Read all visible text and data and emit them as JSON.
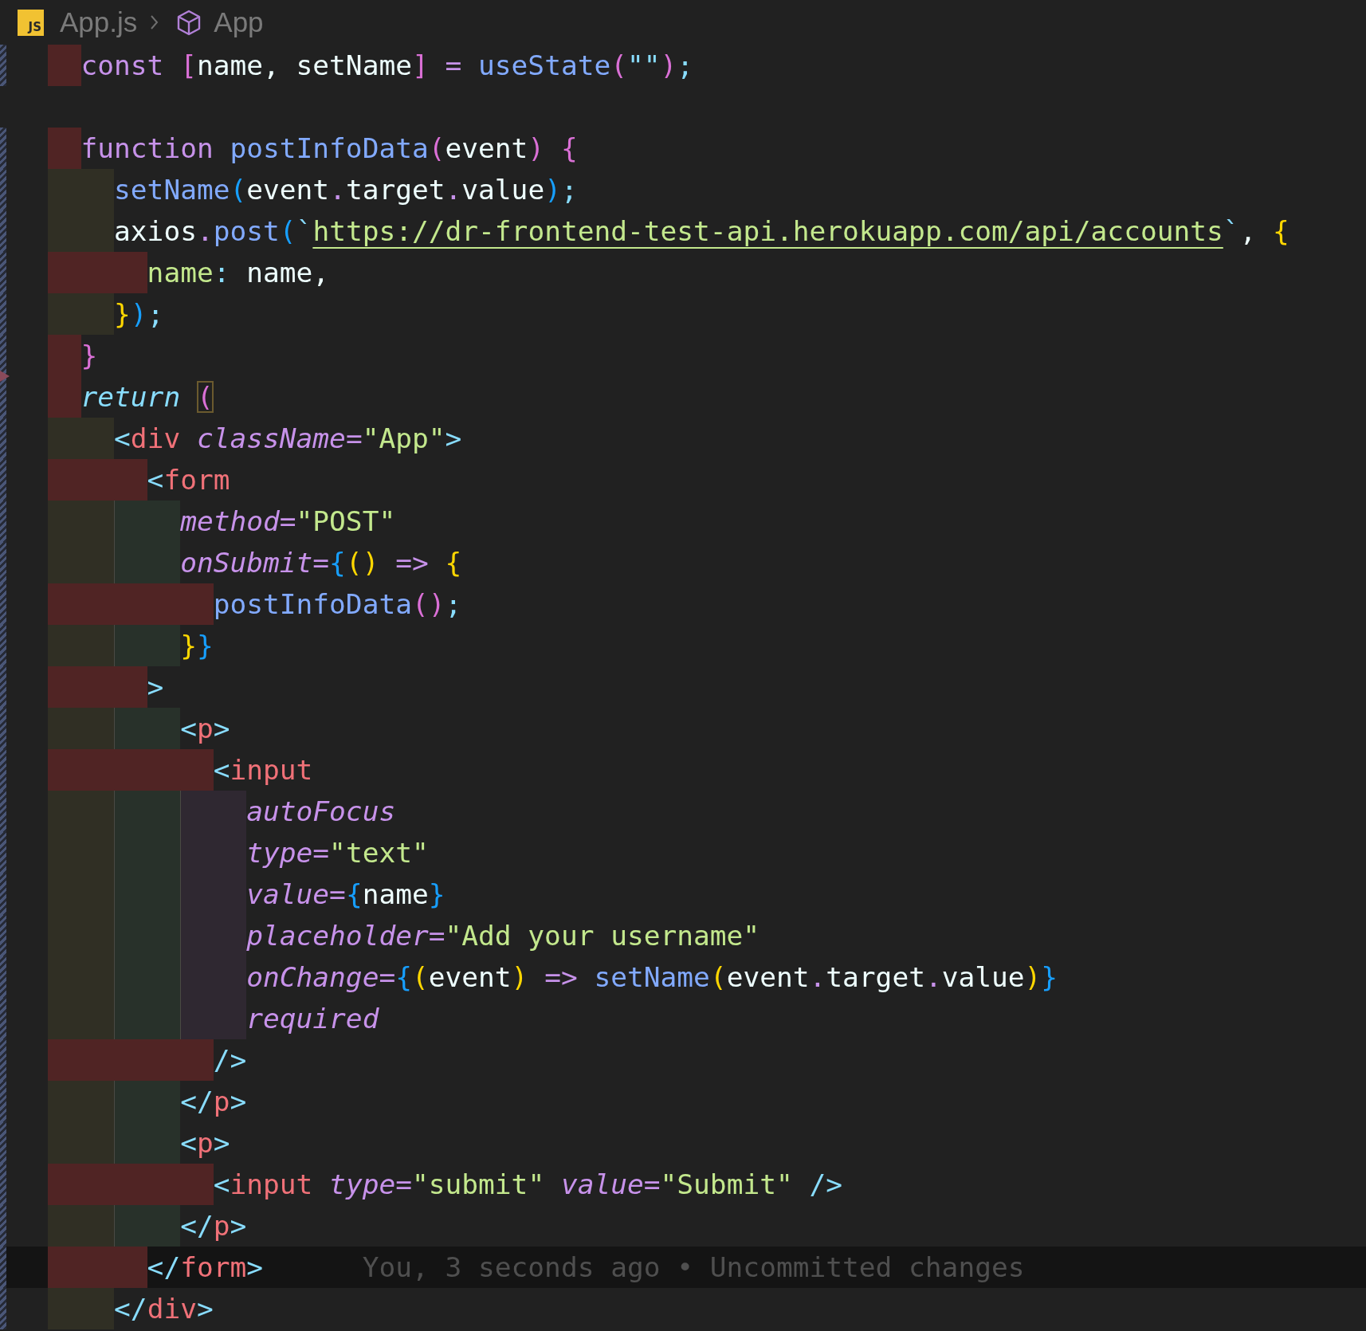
{
  "breadcrumbs": {
    "file_icon_label": "JS",
    "file": "App.js",
    "symbol": "App"
  },
  "lines": [
    {
      "changed": true,
      "tokens": [
        {
          "kind": "kw",
          "text": "const "
        },
        {
          "kind": "b2",
          "text": "["
        },
        {
          "kind": "var",
          "text": "name, setName"
        },
        {
          "kind": "b2",
          "text": "]"
        },
        {
          "kind": "op",
          "text": " = "
        },
        {
          "kind": "fn",
          "text": "useState"
        },
        {
          "kind": "b2",
          "text": "("
        },
        {
          "kind": "punc",
          "text": "\"\""
        },
        {
          "kind": "b2",
          "text": ")"
        },
        {
          "kind": "punc",
          "text": ";"
        }
      ]
    },
    {
      "changed": false
    },
    {
      "changed": true,
      "tokens": [
        {
          "kind": "kw",
          "text": "function "
        },
        {
          "kind": "fn",
          "text": "postInfoData"
        },
        {
          "kind": "b2",
          "text": "("
        },
        {
          "kind": "var",
          "text": "event"
        },
        {
          "kind": "b2",
          "text": ") {"
        }
      ],
      "children": [
        {
          "changed": true,
          "tokens": [
            {
              "kind": "fn",
              "text": "setName"
            },
            {
              "kind": "b3",
              "text": "("
            },
            {
              "kind": "var",
              "text": "event"
            },
            {
              "kind": "op",
              "text": "."
            },
            {
              "kind": "var",
              "text": "target"
            },
            {
              "kind": "op",
              "text": "."
            },
            {
              "kind": "var",
              "text": "value"
            },
            {
              "kind": "b3",
              "text": ")"
            },
            {
              "kind": "punc",
              "text": ";"
            }
          ]
        },
        {
          "changed": true,
          "tokens": [
            {
              "kind": "var",
              "text": "axios"
            },
            {
              "kind": "op",
              "text": "."
            },
            {
              "kind": "fn",
              "text": "post"
            },
            {
              "kind": "b3",
              "text": "("
            },
            {
              "kind": "punc",
              "text": "`"
            },
            {
              "kind": "link",
              "text": "https://dr-frontend-test-api.herokuapp.com/api/accounts"
            },
            {
              "kind": "punc",
              "text": "`"
            },
            {
              "kind": "var",
              "text": ", "
            },
            {
              "kind": "b1",
              "text": "{"
            }
          ],
          "children": [
            {
              "changed": true,
              "tokens": [
                {
                  "kind": "prop",
                  "text": "name"
                },
                {
                  "kind": "punc",
                  "text": ": "
                },
                {
                  "kind": "var",
                  "text": "name,"
                }
              ]
            }
          ]
        },
        {
          "changed": true,
          "tokens": [
            {
              "kind": "b1",
              "text": "}"
            },
            {
              "kind": "b3",
              "text": ")"
            },
            {
              "kind": "punc",
              "text": ";"
            }
          ]
        }
      ]
    },
    {
      "changed": true,
      "tokens": [
        {
          "kind": "b2",
          "text": "}"
        }
      ]
    },
    {
      "changed": true,
      "deleted_above": true,
      "tokens": [
        {
          "kind": "kwi",
          "text": "return "
        },
        {
          "kind": "bmatch",
          "text": "("
        }
      ],
      "children": [
        {
          "changed": true,
          "tokens": [
            {
              "kind": "punc",
              "text": "<"
            },
            {
              "kind": "tag",
              "text": "div "
            },
            {
              "kind": "attr",
              "text": "className"
            },
            {
              "kind": "op",
              "text": "="
            },
            {
              "kind": "str",
              "text": "\"App\""
            },
            {
              "kind": "punc",
              "text": ">"
            }
          ],
          "children": [
            {
              "changed": true,
              "tokens": [
                {
                  "kind": "punc",
                  "text": "<"
                },
                {
                  "kind": "tag",
                  "text": "form"
                }
              ],
              "children": [
                {
                  "changed": true,
                  "tokens": [
                    {
                      "kind": "attr",
                      "text": "method"
                    },
                    {
                      "kind": "op",
                      "text": "="
                    },
                    {
                      "kind": "str",
                      "text": "\"POST\""
                    }
                  ]
                },
                {
                  "changed": true,
                  "tokens": [
                    {
                      "kind": "attr",
                      "text": "onSubmit"
                    },
                    {
                      "kind": "op",
                      "text": "="
                    },
                    {
                      "kind": "b3",
                      "text": "{"
                    },
                    {
                      "kind": "b1",
                      "text": "()"
                    },
                    {
                      "kind": "op",
                      "text": " => "
                    },
                    {
                      "kind": "b1",
                      "text": "{"
                    }
                  ],
                  "children": [
                    {
                      "changed": true,
                      "tokens": [
                        {
                          "kind": "fn",
                          "text": "postInfoData"
                        },
                        {
                          "kind": "b2",
                          "text": "()"
                        },
                        {
                          "kind": "punc",
                          "text": ";"
                        }
                      ]
                    }
                  ]
                },
                {
                  "changed": true,
                  "tokens": [
                    {
                      "kind": "b1",
                      "text": "}"
                    },
                    {
                      "kind": "b3",
                      "text": "}"
                    }
                  ]
                }
              ]
            },
            {
              "changed": true,
              "tokens": [
                {
                  "kind": "punc",
                  "text": ">"
                }
              ],
              "children": [
                {
                  "changed": true,
                  "tokens": [
                    {
                      "kind": "punc",
                      "text": "<"
                    },
                    {
                      "kind": "tag",
                      "text": "p"
                    },
                    {
                      "kind": "punc",
                      "text": ">"
                    }
                  ],
                  "children": [
                    {
                      "changed": true,
                      "tokens": [
                        {
                          "kind": "punc",
                          "text": "<"
                        },
                        {
                          "kind": "tag",
                          "text": "input"
                        }
                      ],
                      "children": [
                        {
                          "changed": true,
                          "tokens": [
                            {
                              "kind": "attr",
                              "text": "autoFocus"
                            }
                          ]
                        },
                        {
                          "changed": true,
                          "tokens": [
                            {
                              "kind": "attr",
                              "text": "type"
                            },
                            {
                              "kind": "op",
                              "text": "="
                            },
                            {
                              "kind": "str",
                              "text": "\"text\""
                            }
                          ]
                        },
                        {
                          "changed": true,
                          "tokens": [
                            {
                              "kind": "attr",
                              "text": "value"
                            },
                            {
                              "kind": "op",
                              "text": "="
                            },
                            {
                              "kind": "b3",
                              "text": "{"
                            },
                            {
                              "kind": "var",
                              "text": "name"
                            },
                            {
                              "kind": "b3",
                              "text": "}"
                            }
                          ]
                        },
                        {
                          "changed": true,
                          "tokens": [
                            {
                              "kind": "attr",
                              "text": "placeholder"
                            },
                            {
                              "kind": "op",
                              "text": "="
                            },
                            {
                              "kind": "str",
                              "text": "\"Add your username\""
                            }
                          ]
                        },
                        {
                          "changed": true,
                          "tokens": [
                            {
                              "kind": "attr",
                              "text": "onChange"
                            },
                            {
                              "kind": "op",
                              "text": "="
                            },
                            {
                              "kind": "b3",
                              "text": "{"
                            },
                            {
                              "kind": "b1",
                              "text": "("
                            },
                            {
                              "kind": "var",
                              "text": "event"
                            },
                            {
                              "kind": "b1",
                              "text": ")"
                            },
                            {
                              "kind": "op",
                              "text": " => "
                            },
                            {
                              "kind": "fn",
                              "text": "setName"
                            },
                            {
                              "kind": "b1",
                              "text": "("
                            },
                            {
                              "kind": "var",
                              "text": "event"
                            },
                            {
                              "kind": "op",
                              "text": "."
                            },
                            {
                              "kind": "var",
                              "text": "target"
                            },
                            {
                              "kind": "op",
                              "text": "."
                            },
                            {
                              "kind": "var",
                              "text": "value"
                            },
                            {
                              "kind": "b1",
                              "text": ")"
                            },
                            {
                              "kind": "b3",
                              "text": "}"
                            }
                          ]
                        },
                        {
                          "changed": true,
                          "tokens": [
                            {
                              "kind": "attr",
                              "text": "required"
                            }
                          ]
                        }
                      ]
                    },
                    {
                      "changed": true,
                      "tokens": [
                        {
                          "kind": "punc",
                          "text": "/>"
                        }
                      ]
                    }
                  ]
                },
                {
                  "changed": true,
                  "tokens": [
                    {
                      "kind": "punc",
                      "text": "</"
                    },
                    {
                      "kind": "tag",
                      "text": "p"
                    },
                    {
                      "kind": "punc",
                      "text": ">"
                    }
                  ]
                },
                {
                  "changed": true,
                  "tokens": [
                    {
                      "kind": "punc",
                      "text": "<"
                    },
                    {
                      "kind": "tag",
                      "text": "p"
                    },
                    {
                      "kind": "punc",
                      "text": ">"
                    }
                  ],
                  "children": [
                    {
                      "changed": true,
                      "tokens": [
                        {
                          "kind": "punc",
                          "text": "<"
                        },
                        {
                          "kind": "tag",
                          "text": "input "
                        },
                        {
                          "kind": "attr",
                          "text": "type"
                        },
                        {
                          "kind": "op",
                          "text": "="
                        },
                        {
                          "kind": "str",
                          "text": "\"submit\" "
                        },
                        {
                          "kind": "attr",
                          "text": "value"
                        },
                        {
                          "kind": "op",
                          "text": "="
                        },
                        {
                          "kind": "str",
                          "text": "\"Submit\" "
                        },
                        {
                          "kind": "punc",
                          "text": "/>"
                        }
                      ]
                    }
                  ]
                },
                {
                  "changed": true,
                  "tokens": [
                    {
                      "kind": "punc",
                      "text": "</"
                    },
                    {
                      "kind": "tag",
                      "text": "p"
                    },
                    {
                      "kind": "punc",
                      "text": ">"
                    }
                  ]
                }
              ]
            },
            {
              "changed": true,
              "current": true,
              "blame": "You, 3 seconds ago • Uncommitted changes",
              "tokens": [
                {
                  "kind": "punc",
                  "text": "</"
                },
                {
                  "kind": "tag",
                  "text": "form"
                },
                {
                  "kind": "punc",
                  "text": ">"
                }
              ]
            }
          ]
        },
        {
          "changed": true,
          "tokens": [
            {
              "kind": "punc",
              "text": "</"
            },
            {
              "kind": "tag",
              "text": "div"
            },
            {
              "kind": "punc",
              "text": ">"
            }
          ]
        }
      ]
    }
  ]
}
